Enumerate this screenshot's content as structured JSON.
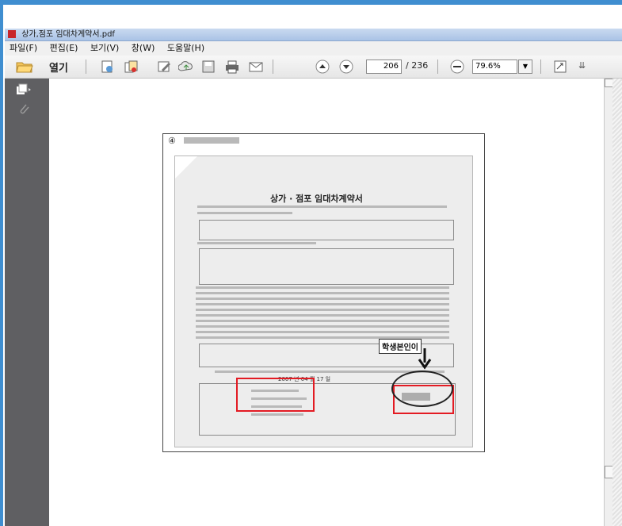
{
  "window": {
    "title": "상가,점포 임대차계약서.pdf"
  },
  "menu": {
    "items": [
      "파일(F)",
      "편집(E)",
      "보기(V)",
      "창(W)",
      "도움말(H)"
    ]
  },
  "toolbar": {
    "open_label": "열기",
    "page_current": "206",
    "page_total": "/ 236",
    "zoom": "79.6%"
  },
  "document": {
    "page_number_mark": "④",
    "title": "상가 · 점포 임대차계약서",
    "annotation": "학생본인이",
    "sign_date": "2007 년 04 월 17 일"
  },
  "icons": {
    "open": "folder-open-icon",
    "save": "save-icon",
    "print": "print-icon",
    "email": "email-icon",
    "prev": "page-up-icon",
    "next": "page-down-icon",
    "zoomout": "zoom-out-icon"
  },
  "colors": {
    "frame": "#3f8ed0",
    "nav_pane": "#5f5f62",
    "annotation_red": "#e31b23"
  }
}
